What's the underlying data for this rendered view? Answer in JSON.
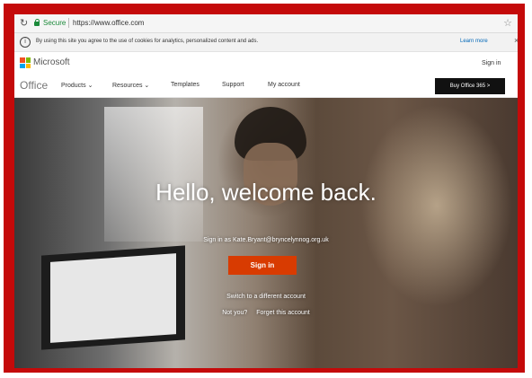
{
  "browser": {
    "reload_icon": "↻",
    "secure_label": "Secure",
    "url": "https://www.office.com",
    "star_icon": "☆"
  },
  "cookie_banner": {
    "text": "By using this site you agree to the use of cookies for analytics, personalized content and ads.",
    "learn_more": "Learn more",
    "close": "×"
  },
  "ms_header": {
    "brand": "Microsoft",
    "sign_in": "Sign in"
  },
  "office_nav": {
    "brand": "Office",
    "items": [
      "Products ⌄",
      "Resources ⌄",
      "Templates",
      "Support",
      "My account"
    ],
    "buy_button": "Buy Office 365  >"
  },
  "hero": {
    "headline": "Hello, welcome back.",
    "signed_in_as": "Sign in as Kate.Bryant@bryncelynnog.org.uk",
    "sign_in_button": "Sign in",
    "switch_account": "Switch to a different account",
    "not_you": "Not you?",
    "forget_account": "Forget this account"
  },
  "colors": {
    "frame": "#c40a0a",
    "sign_in_button": "#d83b01",
    "buy_button": "#111111",
    "link": "#0067b8"
  }
}
